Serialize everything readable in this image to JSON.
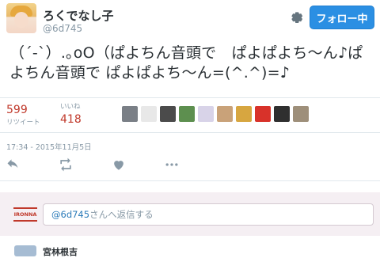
{
  "user": {
    "display_name": "ろくでなし子",
    "screen_name": "@6d745"
  },
  "header": {
    "follow_label": "フォロー中"
  },
  "tweet": {
    "text": "（´-`）.｡oO（ぱよちん音頭で　ぱよぱよち〜ん♪ぱよちん音頭で ぱよぱよち〜ん=(^.^)=♪"
  },
  "stats": {
    "retweets": {
      "value": "599",
      "label": "リツイート"
    },
    "likes": {
      "value": "418",
      "label": "いいね"
    }
  },
  "liked_by": {
    "avatars": [
      {
        "name": "fav-avatar-1",
        "color": "#7a7f86"
      },
      {
        "name": "fav-avatar-2",
        "color": "#e8e8e8"
      },
      {
        "name": "fav-avatar-3",
        "color": "#4b4b4b"
      },
      {
        "name": "fav-avatar-4",
        "color": "#5d8f4f"
      },
      {
        "name": "fav-avatar-5",
        "color": "#d8d3e8"
      },
      {
        "name": "fav-avatar-6",
        "color": "#c9a279"
      },
      {
        "name": "fav-avatar-7",
        "color": "#d7a640"
      },
      {
        "name": "fav-avatar-8",
        "color": "#d8322a"
      },
      {
        "name": "fav-avatar-9",
        "color": "#2f2f2f"
      },
      {
        "name": "fav-avatar-10",
        "color": "#9e8f7a"
      }
    ]
  },
  "timestamp": "17:34 - 2015年11月5日",
  "reply": {
    "logo_text": "IRONNA",
    "handle": "@6d745",
    "placeholder_rest": "さんへ返信する"
  },
  "next_tweet": {
    "name": "宮林根吉"
  },
  "colors": {
    "accent": "#2b8fe3",
    "count": "#c0392b",
    "muted": "#8899a6",
    "reply_bg": "#f5eff3"
  }
}
